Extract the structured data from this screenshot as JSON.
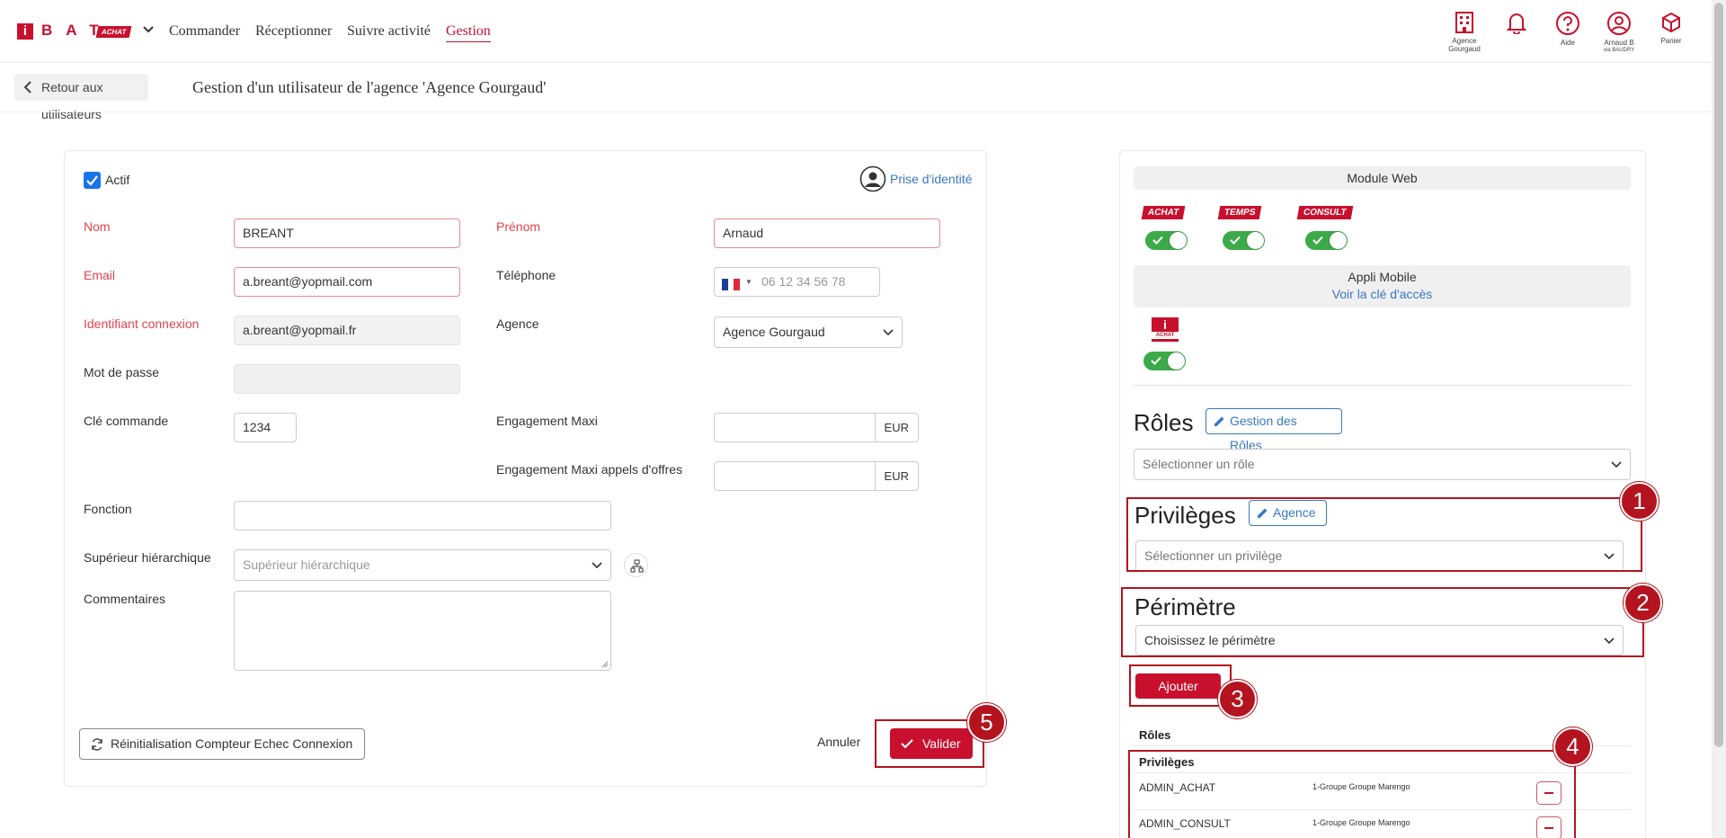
{
  "brand": {
    "logo_letter": "i",
    "logo_text": "BAT",
    "badge": "ACHAT",
    "primary_color": "#c8102e",
    "link_color": "#3a78c4"
  },
  "nav": {
    "items": [
      {
        "label": "Commander"
      },
      {
        "label": "Réceptionner"
      },
      {
        "label": "Suivre activité"
      },
      {
        "label": "Gestion",
        "active": true
      }
    ]
  },
  "top_icons": {
    "agency": {
      "icon": "building-icon",
      "line1": "Agence",
      "line2": "Gourgaud"
    },
    "notifications": {
      "icon": "bell-icon"
    },
    "help": {
      "icon": "help-icon",
      "label": "Aide"
    },
    "user": {
      "icon": "user-icon",
      "line1": "Arnaud B",
      "line2": "via BAUDRY"
    },
    "cart": {
      "icon": "cart-icon",
      "label": "Panier"
    }
  },
  "subheader": {
    "back_label": "Retour aux utilisateurs",
    "title": "Gestion d'un utilisateur de l'agence 'Agence Gourgaud'"
  },
  "form": {
    "active_label": "Actif",
    "active_checked": true,
    "impersonate_label": "Prise d'identité",
    "nom_label": "Nom",
    "nom_value": "BREANT",
    "prenom_label": "Prénom",
    "prenom_value": "Arnaud",
    "email_label": "Email",
    "email_value": "a.breant@yopmail.com",
    "phone_label": "Téléphone",
    "phone_placeholder": "06 12 34 56 78",
    "login_label": "Identifiant connexion",
    "login_value": "a.breant@yopmail.fr",
    "agence_label": "Agence",
    "agence_value": "Agence Gourgaud",
    "password_label": "Mot de passe",
    "cle_label": "Clé commande",
    "cle_value": "1234",
    "engagement_label": "Engagement Maxi",
    "engagement_unit": "EUR",
    "engagement_ao_label": "Engagement Maxi appels d'offres",
    "engagement_ao_unit": "EUR",
    "fonction_label": "Fonction",
    "superieur_label": "Supérieur hiérarchique",
    "superieur_placeholder": "Supérieur hiérarchique",
    "commentaires_label": "Commentaires",
    "reset_label": "Réinitialisation Compteur Echec Connexion",
    "cancel_label": "Annuler",
    "submit_label": "Valider"
  },
  "rights": {
    "module_web_label": "Module Web",
    "modules": [
      {
        "tag": "ACHAT",
        "enabled": true
      },
      {
        "tag": "TEMPS",
        "enabled": true
      },
      {
        "tag": "CONSULT",
        "enabled": true
      }
    ],
    "mobile_label": "Appli Mobile",
    "mobile_key_link": "Voir la clé d'accès",
    "mobile_logo_letter": "i",
    "mobile_logo_sub": "ACHAT",
    "mobile_enabled": true,
    "roles_title": "Rôles",
    "roles_manage_label": "Gestion des Rôles",
    "roles_placeholder": "Sélectionner un rôle",
    "priv_title": "Privilèges",
    "priv_agence_label": "Agence",
    "priv_placeholder": "Sélectionner un privilège",
    "perimetre_title": "Périmètre",
    "perimetre_placeholder": "Choisissez le périmètre",
    "add_label": "Ajouter",
    "table_roles_head": "Rôles",
    "table_priv_head": "Privilèges",
    "privileges": [
      {
        "name": "ADMIN_ACHAT",
        "scope": "1-Groupe Groupe Marengo"
      },
      {
        "name": "ADMIN_CONSULT",
        "scope": "1-Groupe Groupe Marengo"
      }
    ]
  },
  "annotations": [
    "1",
    "2",
    "3",
    "4",
    "5"
  ]
}
